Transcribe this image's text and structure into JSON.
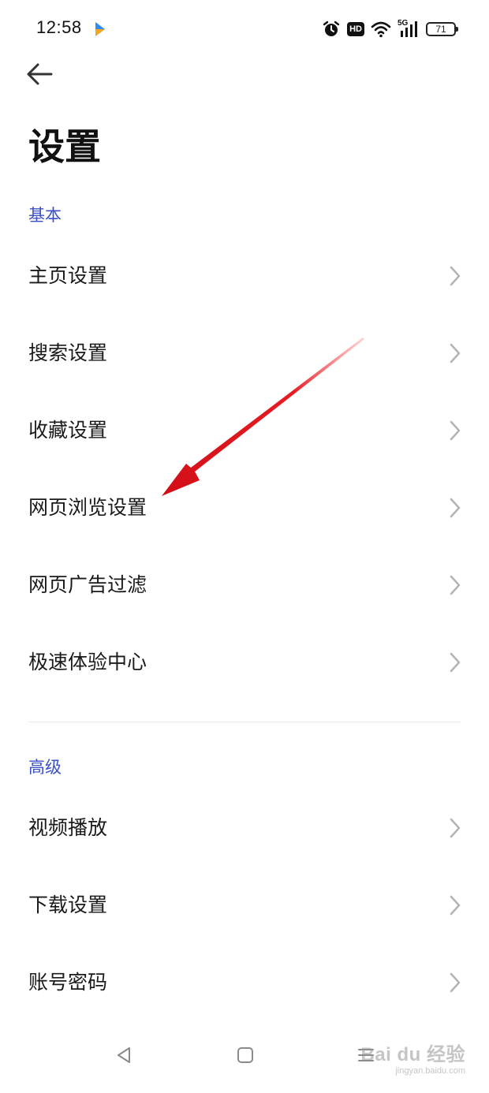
{
  "status_bar": {
    "time": "12:58",
    "network": "5G",
    "hd_badge": "HD",
    "battery_level": "71"
  },
  "page": {
    "title": "设置"
  },
  "sections": [
    {
      "header": "基本",
      "items": [
        {
          "label": "主页设置"
        },
        {
          "label": "搜索设置"
        },
        {
          "label": "收藏设置"
        },
        {
          "label": "网页浏览设置"
        },
        {
          "label": "网页广告过滤"
        },
        {
          "label": "极速体验中心"
        }
      ]
    },
    {
      "header": "高级",
      "items": [
        {
          "label": "视频播放"
        },
        {
          "label": "下载设置"
        },
        {
          "label": "账号密码"
        }
      ]
    }
  ],
  "watermark": {
    "logo": "Bai du 经验",
    "url": "jingyan.baidu.com"
  },
  "colors": {
    "section_header": "#3b4fc4",
    "annotation_arrow": "#e0141e",
    "text_primary": "#1a1a1a",
    "chevron": "#b5b5b5"
  },
  "icons": {
    "back": "arrow-left-icon",
    "chevron": "chevron-right-icon",
    "alarm": "alarm-icon",
    "wifi": "wifi-icon",
    "signal": "signal-icon"
  }
}
